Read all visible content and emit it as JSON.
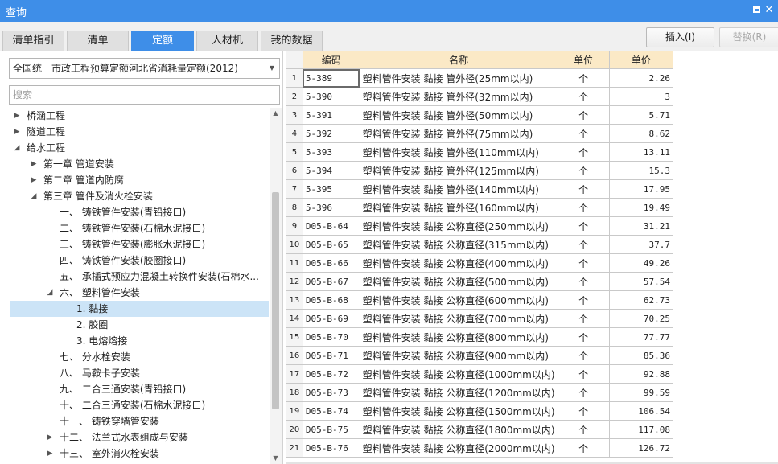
{
  "window": {
    "title": "查询",
    "maximize_icon": "maximize-icon",
    "close_icon": "✕"
  },
  "tabs": [
    {
      "label": "清单指引",
      "active": false
    },
    {
      "label": "清单",
      "active": false
    },
    {
      "label": "定额",
      "active": true
    },
    {
      "label": "人材机",
      "active": false
    },
    {
      "label": "我的数据",
      "active": false
    }
  ],
  "toolbar": {
    "insert_label": "插入(I)",
    "replace_label": "替换(R)"
  },
  "quota_library": {
    "selected": "全国统一市政工程预算定额河北省消耗量定额(2012)"
  },
  "search": {
    "placeholder": "搜索",
    "value": ""
  },
  "tree": [
    {
      "label": "桥涵工程",
      "level": 0,
      "expander": "right"
    },
    {
      "label": "隧道工程",
      "level": 0,
      "expander": "right"
    },
    {
      "label": "给水工程",
      "level": 0,
      "expander": "down"
    },
    {
      "label": "第一章 管道安装",
      "level": 1,
      "expander": "right"
    },
    {
      "label": "第二章 管道内防腐",
      "level": 1,
      "expander": "right"
    },
    {
      "label": "第三章 管件及消火栓安装",
      "level": 1,
      "expander": "down"
    },
    {
      "label": "一、 铸铁管件安装(青铅接口)",
      "level": 2,
      "expander": "none"
    },
    {
      "label": "二、 铸铁管件安装(石棉水泥接口)",
      "level": 2,
      "expander": "none"
    },
    {
      "label": "三、 铸铁管件安装(膨胀水泥接口)",
      "level": 2,
      "expander": "none"
    },
    {
      "label": "四、 铸铁管件安装(胶圈接口)",
      "level": 2,
      "expander": "none"
    },
    {
      "label": "五、 承插式预应力混凝土转换件安装(石棉水...",
      "level": 2,
      "expander": "none"
    },
    {
      "label": "六、 塑料管件安装",
      "level": 2,
      "expander": "down"
    },
    {
      "label": "1. 黏接",
      "level": 3,
      "expander": "none",
      "selected": true
    },
    {
      "label": "2. 胶圈",
      "level": 3,
      "expander": "none"
    },
    {
      "label": "3. 电熔熔接",
      "level": 3,
      "expander": "none"
    },
    {
      "label": "七、 分水栓安装",
      "level": 2,
      "expander": "none"
    },
    {
      "label": "八、 马鞍卡子安装",
      "level": 2,
      "expander": "none"
    },
    {
      "label": "九、 二合三通安装(青铅接口)",
      "level": 2,
      "expander": "none"
    },
    {
      "label": "十、 二合三通安装(石棉水泥接口)",
      "level": 2,
      "expander": "none"
    },
    {
      "label": "十一、 铸铁穿墙管安装",
      "level": 2,
      "expander": "none"
    },
    {
      "label": "十二、 法兰式水表组成与安装",
      "level": 2,
      "expander": "right"
    },
    {
      "label": "十三、 室外消火栓安装",
      "level": 2,
      "expander": "right"
    }
  ],
  "table": {
    "columns": [
      "编码",
      "名称",
      "单位",
      "单价"
    ],
    "rows": [
      {
        "idx": "1",
        "code": "5-389",
        "name": "塑料管件安装 黏接 管外径(25mm以内)",
        "unit": "个",
        "price": "2.26"
      },
      {
        "idx": "2",
        "code": "5-390",
        "name": "塑料管件安装 黏接 管外径(32mm以内)",
        "unit": "个",
        "price": "3"
      },
      {
        "idx": "3",
        "code": "5-391",
        "name": "塑料管件安装 黏接 管外径(50mm以内)",
        "unit": "个",
        "price": "5.71"
      },
      {
        "idx": "4",
        "code": "5-392",
        "name": "塑料管件安装 黏接 管外径(75mm以内)",
        "unit": "个",
        "price": "8.62"
      },
      {
        "idx": "5",
        "code": "5-393",
        "name": "塑料管件安装 黏接 管外径(110mm以内)",
        "unit": "个",
        "price": "13.11"
      },
      {
        "idx": "6",
        "code": "5-394",
        "name": "塑料管件安装 黏接 管外径(125mm以内)",
        "unit": "个",
        "price": "15.3"
      },
      {
        "idx": "7",
        "code": "5-395",
        "name": "塑料管件安装 黏接 管外径(140mm以内)",
        "unit": "个",
        "price": "17.95"
      },
      {
        "idx": "8",
        "code": "5-396",
        "name": "塑料管件安装 黏接 管外径(160mm以内)",
        "unit": "个",
        "price": "19.49"
      },
      {
        "idx": "9",
        "code": "D05-B-64",
        "name": "塑料管件安装 黏接 公称直径(250mm以内)",
        "unit": "个",
        "price": "31.21"
      },
      {
        "idx": "10",
        "code": "D05-B-65",
        "name": "塑料管件安装 黏接 公称直径(315mm以内)",
        "unit": "个",
        "price": "37.7"
      },
      {
        "idx": "11",
        "code": "D05-B-66",
        "name": "塑料管件安装 黏接 公称直径(400mm以内)",
        "unit": "个",
        "price": "49.26"
      },
      {
        "idx": "12",
        "code": "D05-B-67",
        "name": "塑料管件安装 黏接 公称直径(500mm以内)",
        "unit": "个",
        "price": "57.54"
      },
      {
        "idx": "13",
        "code": "D05-B-68",
        "name": "塑料管件安装 黏接 公称直径(600mm以内)",
        "unit": "个",
        "price": "62.73"
      },
      {
        "idx": "14",
        "code": "D05-B-69",
        "name": "塑料管件安装 黏接 公称直径(700mm以内)",
        "unit": "个",
        "price": "70.25"
      },
      {
        "idx": "15",
        "code": "D05-B-70",
        "name": "塑料管件安装 黏接 公称直径(800mm以内)",
        "unit": "个",
        "price": "77.77"
      },
      {
        "idx": "16",
        "code": "D05-B-71",
        "name": "塑料管件安装 黏接 公称直径(900mm以内)",
        "unit": "个",
        "price": "85.36"
      },
      {
        "idx": "17",
        "code": "D05-B-72",
        "name": "塑料管件安装 黏接 公称直径(1000mm以内)",
        "unit": "个",
        "price": "92.88"
      },
      {
        "idx": "18",
        "code": "D05-B-73",
        "name": "塑料管件安装 黏接 公称直径(1200mm以内)",
        "unit": "个",
        "price": "99.59"
      },
      {
        "idx": "19",
        "code": "D05-B-74",
        "name": "塑料管件安装 黏接 公称直径(1500mm以内)",
        "unit": "个",
        "price": "106.54"
      },
      {
        "idx": "20",
        "code": "D05-B-75",
        "name": "塑料管件安装 黏接 公称直径(1800mm以内)",
        "unit": "个",
        "price": "117.08"
      },
      {
        "idx": "21",
        "code": "D05-B-76",
        "name": "塑料管件安装 黏接 公称直径(2000mm以内)",
        "unit": "个",
        "price": "126.72"
      }
    ]
  },
  "colors": {
    "accent": "#3e8ee8",
    "header_bg": "#fbe9c6",
    "selection": "#cce4f7"
  }
}
